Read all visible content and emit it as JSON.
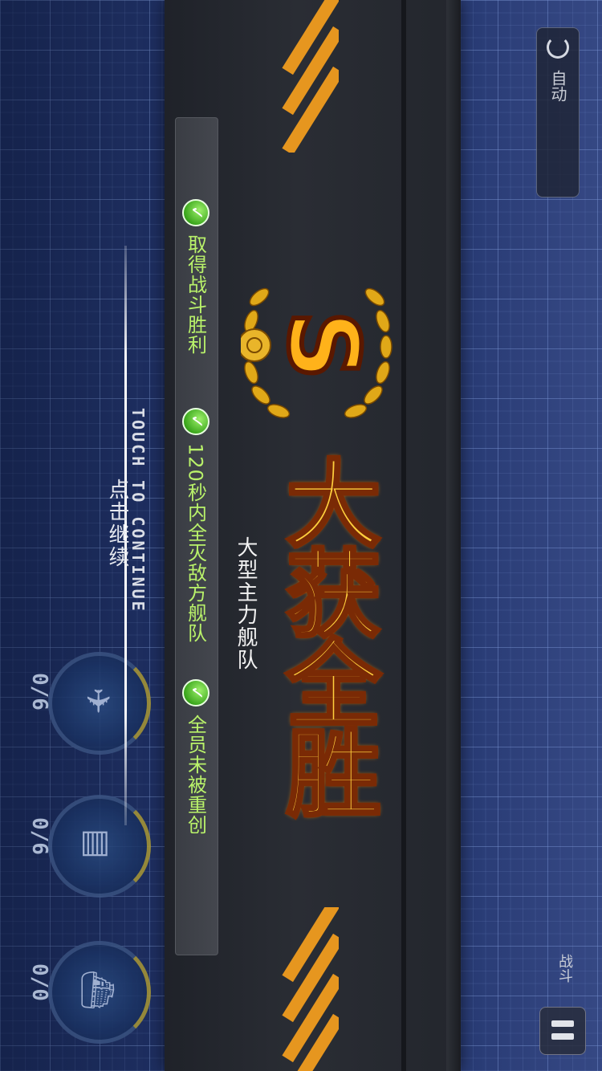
{
  "result": {
    "rank": "S",
    "victory_text": "大获全胜",
    "fleet_name": "大型主力舰队"
  },
  "objectives": [
    {
      "label": "取得战斗胜利",
      "done": true
    },
    {
      "label": "120秒内全灭敌方舰队",
      "done": true
    },
    {
      "label": "全员未被重创",
      "done": true
    }
  ],
  "continue": {
    "en": "TOUCH TO CONTINUE",
    "cn": "点击继续"
  },
  "gauges": [
    {
      "icon": "plane-icon",
      "glyph": "✈",
      "count": "0/6"
    },
    {
      "icon": "torpedo-icon",
      "glyph": "▤",
      "count": "0/6"
    },
    {
      "icon": "ship-icon",
      "glyph": "⛴",
      "count": "0/0"
    }
  ],
  "controls": {
    "auto_label": "自动",
    "mode_label": "战斗"
  },
  "colors": {
    "objective_text": "#b9f26a",
    "hazard": "#e6961f",
    "victory": "#ffcf3d",
    "check": "#3aa61c"
  }
}
